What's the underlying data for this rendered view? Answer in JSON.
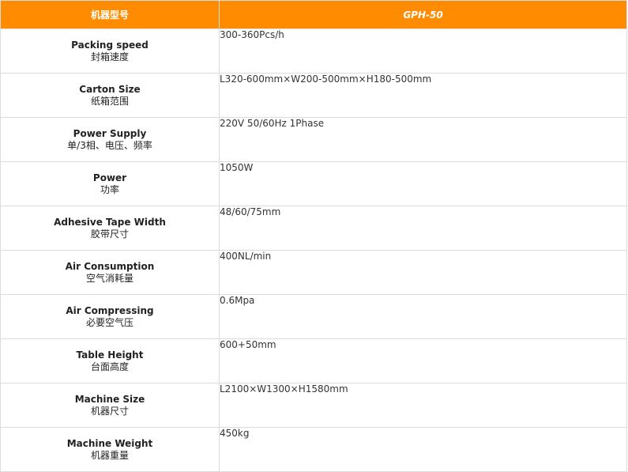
{
  "header": {
    "col1": "机器型号",
    "col2": "GPH-50"
  },
  "rows": [
    {
      "en": "Packing speed",
      "cn": "封箱速度",
      "value": "300-360Pcs/h"
    },
    {
      "en": "Carton Size",
      "cn": "纸箱范围",
      "value": "L320-600mm×W200-500mm×H180-500mm"
    },
    {
      "en": "Power Supply",
      "cn": "单/3相、电压、频率",
      "value": "220V 50/60Hz 1Phase"
    },
    {
      "en": "Power",
      "cn": "功率",
      "value": "1050W"
    },
    {
      "en": "Adhesive Tape Width",
      "cn": "胶带尺寸",
      "value": "48/60/75mm"
    },
    {
      "en": "Air Consumption",
      "cn": "空气消耗量",
      "value": "400NL/min"
    },
    {
      "en": "Air Compressing",
      "cn": "必要空气压",
      "value": "0.6Mpa"
    },
    {
      "en": "Table Height",
      "cn": "台面高度",
      "value": "600+50mm"
    },
    {
      "en": "Machine Size",
      "cn": "机器尺寸",
      "value": "L2100×W1300×H1580mm"
    },
    {
      "en": "Machine Weight",
      "cn": "机器重量",
      "value": "450kg"
    }
  ],
  "colors": {
    "header_bg": "#ff8c00",
    "header_text": "#ffffff",
    "border": "#dcdcdc"
  }
}
